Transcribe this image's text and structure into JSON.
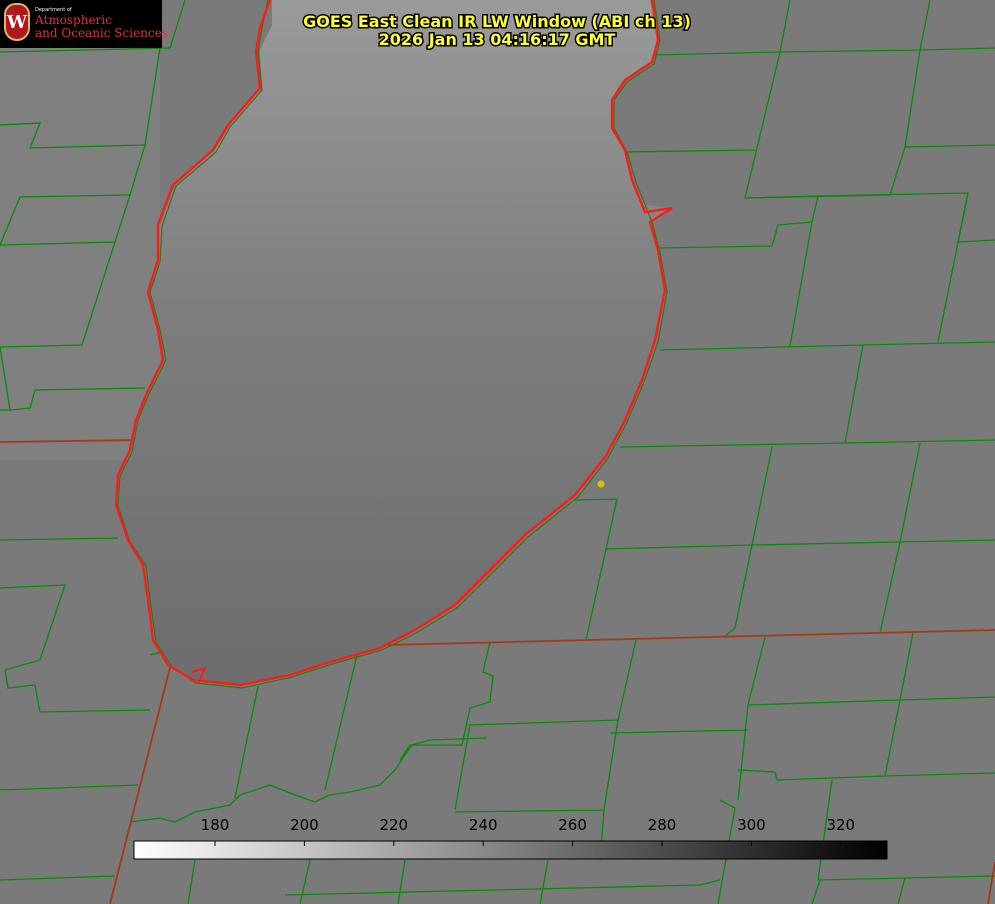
{
  "header": {
    "title_line1": "GOES East Clean IR LW Window (ABI ch 13)",
    "title_line2": "2026 Jan 13 04:16:17 GMT"
  },
  "logo": {
    "seal_letter": "W",
    "department": "Department of",
    "line1": "Atmospheric",
    "line2": "and Oceanic Sciences"
  },
  "colorbar": {
    "ticks": [
      "180",
      "200",
      "220",
      "240",
      "260",
      "280",
      "300",
      "320"
    ],
    "colors": {
      "low": "#ffffff",
      "high": "#000000"
    }
  },
  "colors": {
    "land": "#7c7c7c",
    "lake_top": "#9a9a9a",
    "lake_bottom": "#6e6e6e",
    "shoreline": "#ff1a1a",
    "county_lines": "#0a8a0a",
    "state_lines": "#a23a1a",
    "title_text": "#ffff33",
    "marker": "#d4c400"
  }
}
